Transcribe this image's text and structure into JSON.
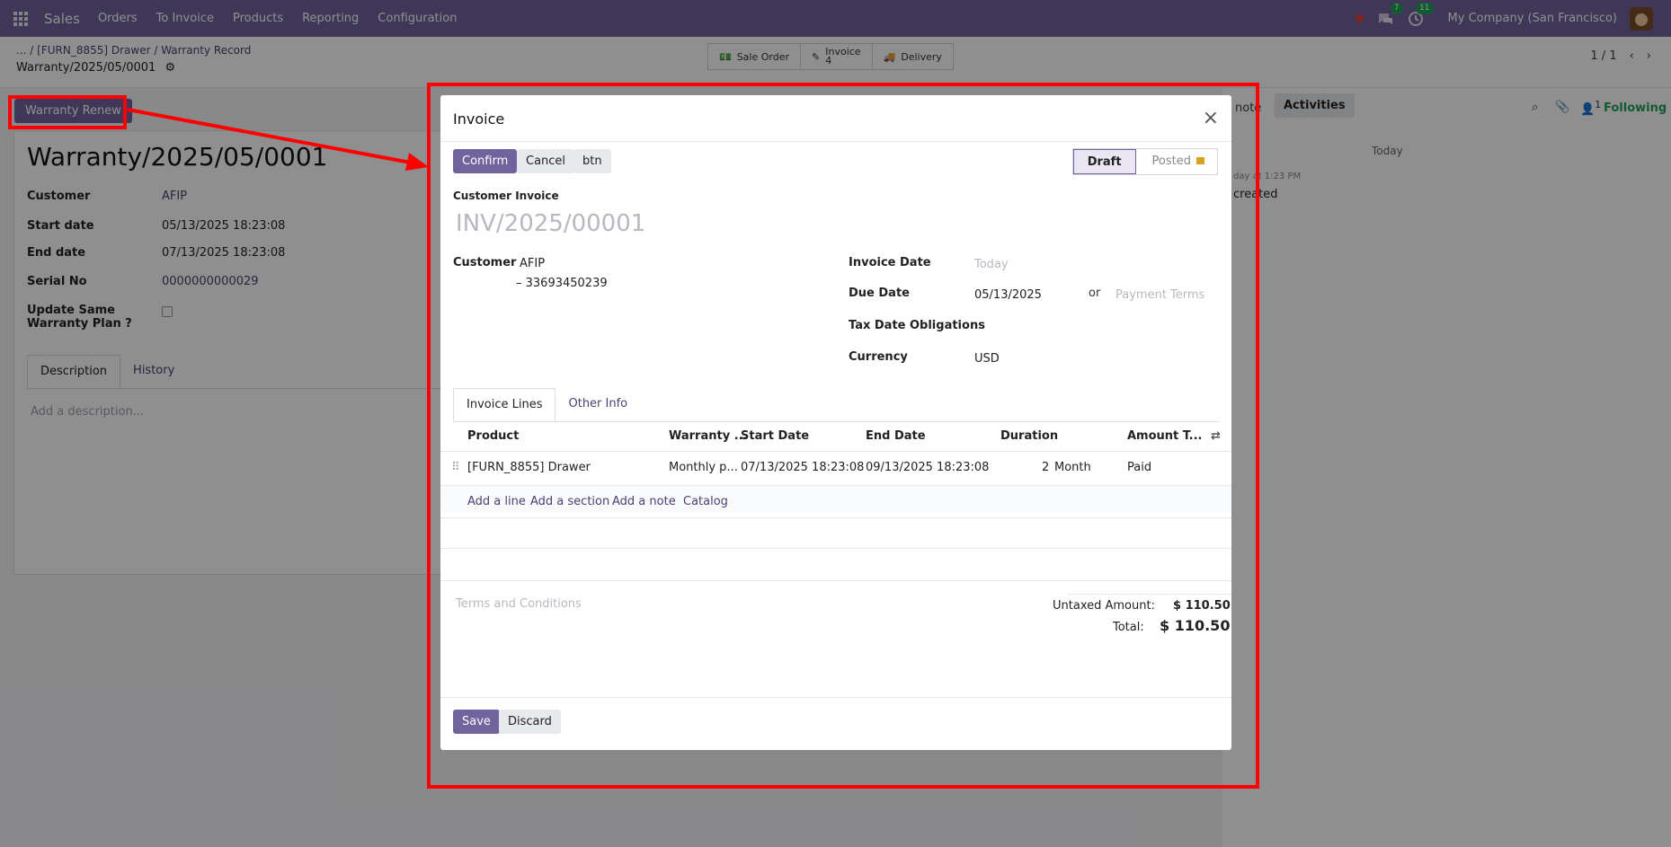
{
  "topbar": {
    "app": "Sales",
    "menu": [
      "Orders",
      "To Invoice",
      "Products",
      "Reporting",
      "Configuration"
    ],
    "messages_count": "7",
    "activities_count": "11",
    "company": "My Company (San Francisco)"
  },
  "breadcrumb": {
    "dots": "...",
    "items": [
      "[FURN_8855] Drawer",
      "Warranty Record"
    ],
    "current": "Warranty/2025/05/0001"
  },
  "smart_buttons": {
    "sale_order": "Sale Order",
    "invoice_label": "Invoice",
    "invoice_count": "4",
    "delivery": "Delivery"
  },
  "pager": {
    "value": "1 / 1"
  },
  "form": {
    "renew_button": "Warranty Renew",
    "title": "Warranty/2025/05/0001",
    "fields": [
      {
        "label": "Customer",
        "value": "AFIP"
      },
      {
        "label": "Start date",
        "value": "05/13/2025 18:23:08"
      },
      {
        "label": "End date",
        "value": "07/13/2025 18:23:08"
      },
      {
        "label": "Serial No",
        "value": "0000000000029"
      },
      {
        "label": "Update Same Warranty Plan ?",
        "value": ""
      }
    ],
    "tabs": [
      "Description",
      "History"
    ],
    "description_placeholder": "Add a description..."
  },
  "chatter": {
    "note": "note",
    "activities": "Activities",
    "following": "Following",
    "followers": "1",
    "today": "Today",
    "msg_time": "day at 1:23 PM",
    "msg_text": "created"
  },
  "modal": {
    "title": "Invoice",
    "buttons": {
      "confirm": "Confirm",
      "cancel": "Cancel",
      "btn": "btn",
      "save": "Save",
      "discard": "Discard"
    },
    "status": {
      "draft": "Draft",
      "posted": "Posted"
    },
    "type_label": "Customer Invoice",
    "number": "INV/2025/00001",
    "customer": {
      "label": "Customer",
      "name": "AFIP",
      "vat": "– 33693450239"
    },
    "invoice_date": {
      "label": "Invoice Date",
      "placeholder": "Today"
    },
    "due_date": {
      "label": "Due Date",
      "value": "05/13/2025",
      "or": "or",
      "terms_placeholder": "Payment Terms"
    },
    "tax_date": {
      "label": "Tax Date Obligations"
    },
    "currency": {
      "label": "Currency",
      "value": "USD"
    },
    "tabs": [
      "Invoice Lines",
      "Other Info"
    ],
    "columns": [
      "Product",
      "Warranty ...",
      "Start Date",
      "End Date",
      "Duration",
      "Amount T..."
    ],
    "lines": [
      {
        "product": "[FURN_8855] Drawer",
        "warranty": "Monthly p...",
        "start": "07/13/2025 18:23:08",
        "end": "09/13/2025 18:23:08",
        "duration": "2",
        "unit": "Month",
        "amount": "Paid"
      }
    ],
    "add_links": [
      "Add a line",
      "Add a section",
      "Add a note",
      "Catalog"
    ],
    "terms_placeholder": "Terms and Conditions",
    "untaxed_label": "Untaxed Amount:",
    "untaxed_value": "$ 110.50",
    "total_label": "Total:",
    "total_value": "$ 110.50"
  },
  "colors": {
    "primary": "#71639e",
    "annotation": "#ff0000"
  }
}
